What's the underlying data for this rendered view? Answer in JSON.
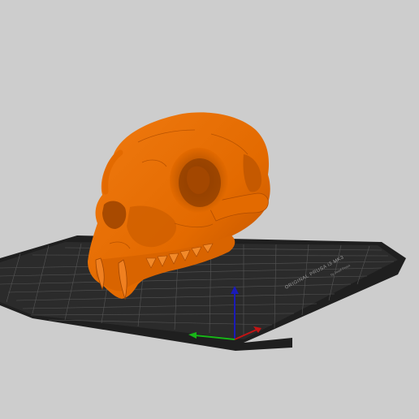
{
  "viewport": {
    "background_color": "#cdcdcd"
  },
  "print_bed": {
    "brand_text": "ORIGINAL PRUSA i3 MK3",
    "sub_text": "by Josef Prusa",
    "plate_color": "#2b2b2b",
    "grid_color": "#5a5a5a"
  },
  "model": {
    "name_icon": "skull-model",
    "color": "#e36a00"
  },
  "axes": {
    "x_color": "#c41414",
    "y_color": "#18b518",
    "z_color": "#1a1ab8"
  }
}
